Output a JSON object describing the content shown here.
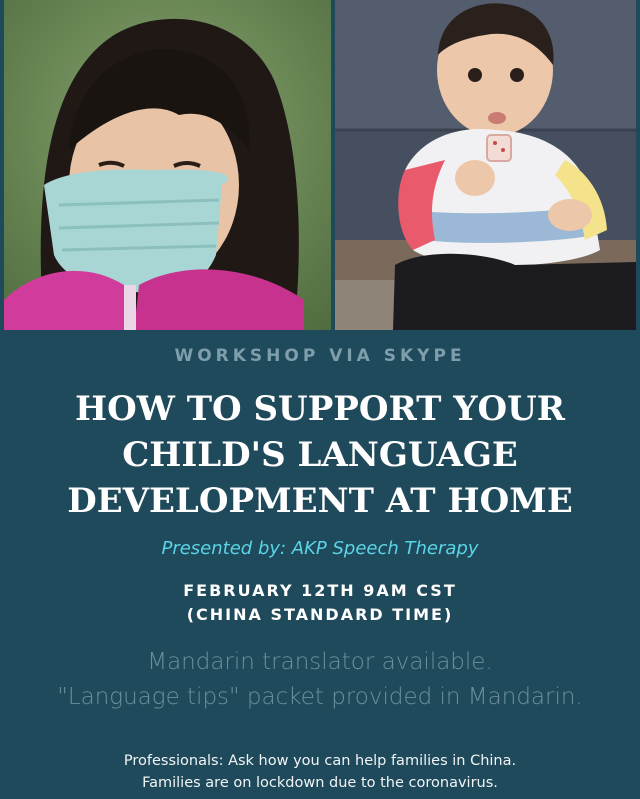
{
  "header": {
    "eyebrow": "WORKSHOP VIA SKYPE"
  },
  "title": {
    "lines": [
      "HOW TO SUPPORT YOUR",
      "CHILD'S LANGUAGE",
      "DEVELOPMENT AT HOME"
    ]
  },
  "presenter": "Presented by: AKP Speech Therapy",
  "date": {
    "lines": [
      "FEBRUARY 12TH 9AM CST",
      "(CHINA STANDARD TIME)"
    ]
  },
  "notes": {
    "lines": [
      "Mandarin translator available.",
      "\"Language tips\" packet provided in Mandarin."
    ]
  },
  "footer": {
    "lines": [
      "Professionals: Ask how you can help families in China.",
      "Families are on lockdown due to the coronavirus."
    ]
  },
  "colors": {
    "background": "#1f4a5b",
    "eyebrow": "#7f9eab",
    "presenter": "#5ad4e6",
    "notes": "#6d8f9b"
  }
}
